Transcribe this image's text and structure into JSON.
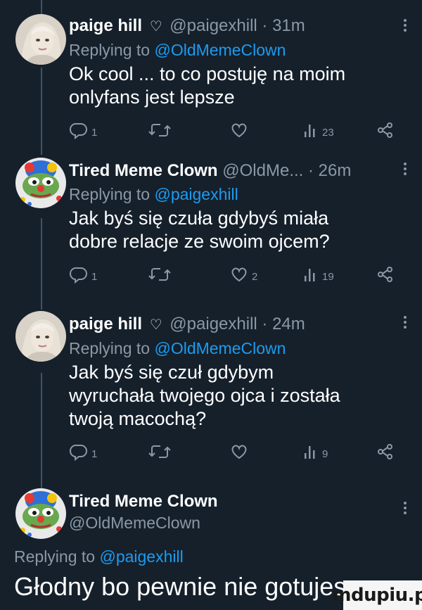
{
  "tweets": [
    {
      "name": "paige hill",
      "badge": "♡",
      "handle": "@paigexhill",
      "time": "31m",
      "reply_label": "Replying to",
      "reply_mention": "@OldMemeClown",
      "text_lines": [
        "Ok cool ... to co postuję na moim",
        "onlyfans jest lepsze"
      ],
      "counts": {
        "reply": "1",
        "retweet": "",
        "like": "",
        "views": "23"
      },
      "avatar_icon": "woman-portrait-avatar"
    },
    {
      "name": "Tired Meme Clown",
      "badge": "",
      "handle": "@OldMe...",
      "time": "26m",
      "reply_label": "Replying to",
      "reply_mention": "@paigexhill",
      "text_lines": [
        "Jak byś się czuła gdybyś miała",
        "dobre relacje ze swoim ojcem?"
      ],
      "counts": {
        "reply": "1",
        "retweet": "",
        "like": "2",
        "views": "19"
      },
      "avatar_icon": "clown-frog-avatar"
    },
    {
      "name": "paige hill",
      "badge": "♡",
      "handle": "@paigexhill",
      "time": "24m",
      "reply_label": "Replying to",
      "reply_mention": "@OldMemeClown",
      "text_lines": [
        "Jak byś się czuł gdybym",
        "wyruchała twojego ojca i została",
        "twoją macochą?"
      ],
      "counts": {
        "reply": "1",
        "retweet": "",
        "like": "",
        "views": "9"
      },
      "avatar_icon": "woman-portrait-avatar"
    }
  ],
  "last_tweet": {
    "name": "Tired Meme Clown",
    "handle": "@OldMemeClown",
    "reply_label": "Replying to",
    "reply_mention": "@paigexhill",
    "text": "Głodny bo pewnie nie gotujesz"
  },
  "watermark": "mdupiu.pl",
  "colors": {
    "background": "#15202b",
    "muted": "#8b98a5",
    "link": "#1d9bf0",
    "text": "#ffffff"
  }
}
